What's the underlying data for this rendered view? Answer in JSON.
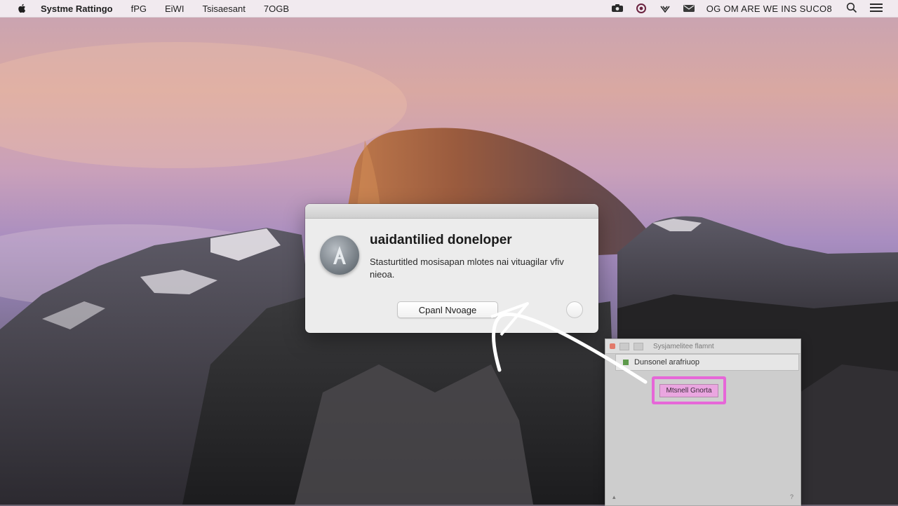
{
  "menubar": {
    "app_name": "Systme Rattingo",
    "menus": [
      "fPG",
      "EiWI",
      "Tsisaesant",
      "7OGB"
    ],
    "clock": "OG OM ARE WE INS SUCO8",
    "status_icons": [
      "camera-icon",
      "record-icon",
      "wifi-icon",
      "mail-icon"
    ]
  },
  "dialog": {
    "heading": "uaidantilied doneloper",
    "message": "Stasturtitled mosisapan mlotes nai vituagilar vfiv nieoa.",
    "open_button": "Cpanl Nvoage",
    "icon": "app-icon"
  },
  "inset": {
    "row_label": "Dunsonel arafriuop",
    "highlight_button": "Mtsnell Gnorta",
    "title": "Sysjamelitee flamnt"
  },
  "colors": {
    "highlight": "#e667d8",
    "dialog_bg": "#ececec"
  }
}
